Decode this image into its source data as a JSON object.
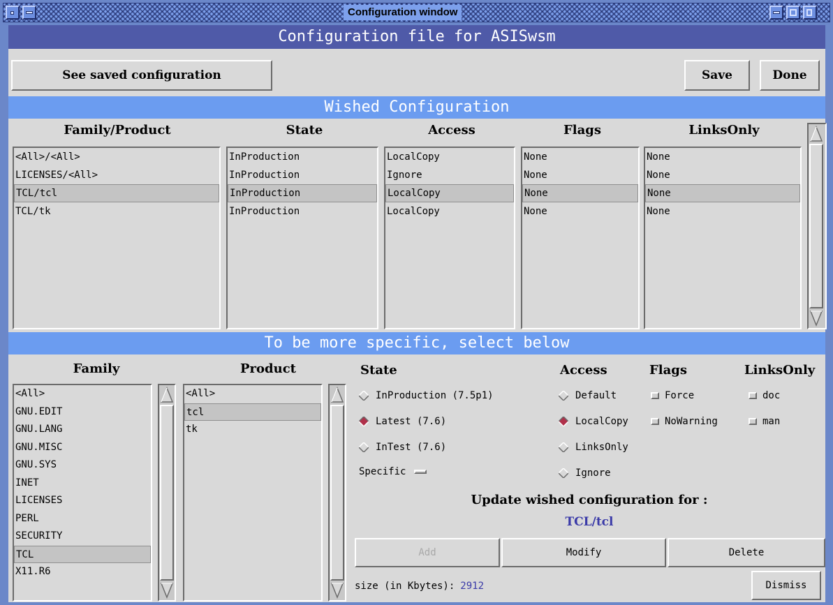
{
  "window": {
    "title": "Configuration window"
  },
  "header": {
    "banner": "Configuration file for ASISwsm"
  },
  "toolbar": {
    "see_saved_label": "See saved configuration",
    "save_label": "Save",
    "done_label": "Done"
  },
  "wished": {
    "banner": "Wished Configuration",
    "columns": {
      "family_product": "Family/Product",
      "state": "State",
      "access": "Access",
      "flags": "Flags",
      "linksonly": "LinksOnly"
    },
    "rows": [
      {
        "family_product": "<All>/<All>",
        "state": "InProduction",
        "access": "LocalCopy",
        "flags": "None",
        "linksonly": "None"
      },
      {
        "family_product": "LICENSES/<All>",
        "state": "InProduction",
        "access": "Ignore",
        "flags": "None",
        "linksonly": "None"
      },
      {
        "family_product": "TCL/tcl",
        "state": "InProduction",
        "access": "LocalCopy",
        "flags": "None",
        "linksonly": "None"
      },
      {
        "family_product": "TCL/tk",
        "state": "InProduction",
        "access": "LocalCopy",
        "flags": "None",
        "linksonly": "None"
      }
    ],
    "selected_row": 2
  },
  "specific": {
    "banner": "To be more specific, select below",
    "family_header": "Family",
    "product_header": "Product",
    "families": [
      "<All>",
      "GNU.EDIT",
      "GNU.LANG",
      "GNU.MISC",
      "GNU.SYS",
      "INET",
      "LICENSES",
      "PERL",
      "SECURITY",
      "TCL",
      "X11.R6"
    ],
    "family_selected": "TCL",
    "products": [
      "<All>",
      "tcl",
      "tk"
    ],
    "product_selected": "tcl",
    "state_header": "State",
    "states": [
      {
        "label": "InProduction (7.5p1)",
        "selected": false
      },
      {
        "label": "Latest (7.6)",
        "selected": true
      },
      {
        "label": "InTest (7.6)",
        "selected": false
      }
    ],
    "specific_label": "Specific",
    "access_header": "Access",
    "access_options": [
      {
        "label": "Default",
        "selected": false
      },
      {
        "label": "LocalCopy",
        "selected": true
      },
      {
        "label": "LinksOnly",
        "selected": false
      },
      {
        "label": "Ignore",
        "selected": false
      }
    ],
    "flags_header": "Flags",
    "flags_options": [
      {
        "label": "Force"
      },
      {
        "label": "NoWarning"
      }
    ],
    "linksonly_header": "LinksOnly",
    "linksonly_options": [
      {
        "label": "doc"
      },
      {
        "label": "man"
      }
    ],
    "update_label": "Update wished configuration for :",
    "update_target": "TCL/tcl",
    "add_label": "Add",
    "modify_label": "Modify",
    "delete_label": "Delete",
    "size_label": "size (in Kbytes):",
    "size_value": "2912",
    "dismiss_label": "Dismiss"
  },
  "colors": {
    "header_banner": "#4f5aa8",
    "section_banner": "#6b9cf0",
    "selected_radio": "#b0304a",
    "accent_text": "#3a3aa8",
    "background": "#d9d9d9"
  }
}
